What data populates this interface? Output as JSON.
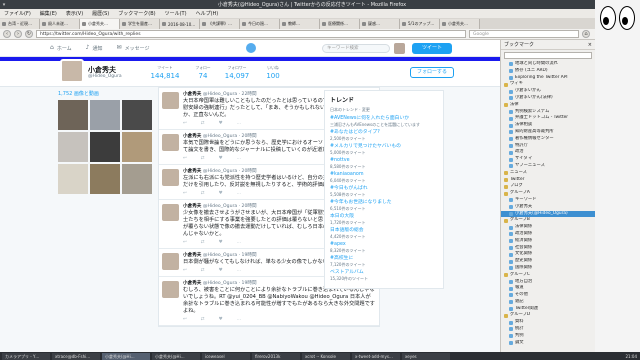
{
  "window": {
    "title": "小倉秀夫(@Hideo_Ogura)さん | Twitterからの反応付きツイート - Mozilla Firefox"
  },
  "menu": [
    "ファイル(F)",
    "編集(E)",
    "表示(V)",
    "履歴(S)",
    "ブックマーク(B)",
    "ツール(T)",
    "ヘルプ(H)"
  ],
  "tabs": [
    {
      "label": "台湾・近現…",
      "active": false
    },
    {
      "label": "殺人未遂…",
      "active": false
    },
    {
      "label": "小倉秀夫…",
      "active": true
    },
    {
      "label": "学生を量産…",
      "active": false
    },
    {
      "label": "2016-08-10…",
      "active": false
    },
    {
      "label": "《共謀罪》…",
      "active": false
    },
    {
      "label": "今日の過…",
      "active": false
    },
    {
      "label": "教師…",
      "active": false
    },
    {
      "label": "医療関係…",
      "active": false
    },
    {
      "label": "疑惑…",
      "active": false
    },
    {
      "label": "5/1のアップ…",
      "active": false
    },
    {
      "label": "小倉秀夫…",
      "active": false
    }
  ],
  "navbar": {
    "url": "https://twitter.com/Hideo_Ogura/with_replies",
    "search_placeholder": "Google"
  },
  "twitter": {
    "nav": [
      "ホーム",
      "通知",
      "メッセージ"
    ],
    "search_placeholder": "キーワード検索",
    "tweet_button": "ツイート",
    "profile": {
      "name": "小倉秀夫",
      "handle": "@Hideo_Ogura",
      "follow_button": "フォローする"
    },
    "stats": [
      {
        "label": "ツイート",
        "value": "144,814"
      },
      {
        "label": "フォロー",
        "value": "74"
      },
      {
        "label": "フォロワー",
        "value": "14,097"
      },
      {
        "label": "いいね",
        "value": "100"
      }
    ],
    "photos_label": "1,752 画像と動画",
    "photos": [
      {
        "color": "#6e6458"
      },
      {
        "color": "#9aa0a8"
      },
      {
        "color": "#4a4a4a"
      },
      {
        "color": "#c6c2bd"
      },
      {
        "color": "#3c3c3c"
      },
      {
        "color": "#b09a7a"
      },
      {
        "color": "#d9d4c8"
      },
      {
        "color": "#8c7b5e"
      },
      {
        "color": "#a49d90"
      }
    ],
    "tweets": [
      {
        "name": "小倉秀夫",
        "handle": "@Hideo_Ogura · 22時間",
        "text": "大日本帝国軍は難しいこともしたのだったとは思っているので、そのことが「従軍慰安婦の強制連行」だったとして、「まあ、そうかもしれないね」くらいの感覚しか、正直ないんだ。"
      },
      {
        "name": "小倉秀夫",
        "handle": "@Hideo_Ogura · 20時間",
        "text": "本気で国際世論をどうにか思うなら、歴史学におけるオーソドックスな手法を用いて論文を書き、国際的なジャーナルに投稿していくのが近道だと思うんだけどね。"
      },
      {
        "name": "小倉秀夫",
        "handle": "@Hideo_Ogura · 20時間",
        "text": "左派にも右派にも党派性を持つ歴史学者はいるけど、自分の主張に都合のいい資料だけを引用したり、反対説を無視したりすると、学術的評価は下がるんだよね。"
      },
      {
        "name": "小倉秀夫",
        "handle": "@Hideo_Ogura · 20時間",
        "text": "少女像を撤去させようがさせまいが、大日本帝国が「従軍慰安婦」を連れ回して兵士たちを相手にする事業を強要したとの評価は覆らないと思うんだけど、その評価が覆らない状態で像の撤去運動だけしていれば、むしろ日本の国際的評価が落ちるんじゃないかと。"
      },
      {
        "name": "小倉秀夫",
        "handle": "@Hideo_Ogura · 19時間",
        "text": "日本側が騒がなくてもしなければ、単なる少女の像でしかないわけだし。"
      },
      {
        "name": "小倉秀夫",
        "handle": "@Hideo_Ogura · 19時間",
        "text": "むしろ、被害をことに何かことにより余計なトラブルに巻き込まれているんじゃないでしょうね。RT @yui_0204_BB @NabiyoWakou @Hideo_Ogura 日本人が余計なトラブルに巻き込まれる可能性が増すでもたがあるなら大きな外交問題ですよね。"
      }
    ],
    "trends_title": "トレンド",
    "trends_subtitle": "日本のトレンド · 変更",
    "trends": [
      {
        "name": "#AVENewsに何を入れたら面白いか",
        "count": "三浦忍さんもAVEnewsのことを話題にしています"
      },
      {
        "name": "#あなたはどのタイプ?",
        "count": "2,500件のツイート"
      },
      {
        "name": "#メルカリで見つけたヤバいもの",
        "count": "5,000件のツイート"
      },
      {
        "name": "#nottve",
        "count": "8,580件のツイート"
      },
      {
        "name": "#kaniaoanom",
        "count": "6,040件のツイート"
      },
      {
        "name": "#今日もがんばれ",
        "count": "5,508件のツイート"
      },
      {
        "name": "#今年もお世話になりました",
        "count": "6,510件のツイート"
      },
      {
        "name": "本日の大阪",
        "count": "1,720件のツイート"
      },
      {
        "name": "日本語版の総会",
        "count": "4,420件のツイート"
      },
      {
        "name": "#apex",
        "count": "8,320件のツイート"
      },
      {
        "name": "#高校生に",
        "count": "7,120件のツイート"
      },
      {
        "name": "ベストアルバム",
        "count": "15,320件のツイート"
      }
    ]
  },
  "sidebar": {
    "title": "ブックマーク",
    "items": [
      {
        "label": "地球と同じ時間の流れ",
        "folder": false,
        "selected": false
      },
      {
        "label": "依存 (ユニ ARD)",
        "folder": false,
        "selected": false
      },
      {
        "label": "Exploring the Twitter API",
        "folder": false,
        "selected": false
      },
      {
        "label": "ウィキ",
        "folder": true,
        "selected": false
      },
      {
        "label": "小倉まいかん",
        "folder": false,
        "selected": false
      },
      {
        "label": "小倉まいかん(法律)",
        "folder": false,
        "selected": false
      },
      {
        "label": "法律",
        "folder": true,
        "selected": false
      },
      {
        "label": "判例検索システム",
        "folder": false,
        "selected": false
      },
      {
        "label": "弁護士ドットコム - Twitter",
        "folder": false,
        "selected": false
      },
      {
        "label": "法律相談",
        "folder": false,
        "selected": false
      },
      {
        "label": "知的財産高等裁判所",
        "folder": false,
        "selected": false
      },
      {
        "label": "著作権情報センター",
        "folder": false,
        "selected": false
      },
      {
        "label": "特許庁",
        "folder": false,
        "selected": false
      },
      {
        "label": "政治",
        "folder": false,
        "selected": false
      },
      {
        "label": "サイタマ",
        "folder": false,
        "selected": false
      },
      {
        "label": "ヤフーニュース",
        "folder": false,
        "selected": false
      },
      {
        "label": "ニュース",
        "folder": true,
        "selected": false
      },
      {
        "label": "Twitter",
        "folder": true,
        "selected": false
      },
      {
        "label": "ブログ",
        "folder": true,
        "selected": false
      },
      {
        "label": "グループA",
        "folder": true,
        "selected": false
      },
      {
        "label": "キーワード",
        "folder": false,
        "selected": false
      },
      {
        "label": "小倉秀夫",
        "folder": false,
        "selected": false
      },
      {
        "label": "小倉秀夫(@Hideo_Ogura)",
        "folder": false,
        "selected": true
      },
      {
        "label": "グループB",
        "folder": true,
        "selected": false
      },
      {
        "label": "法律関係",
        "folder": false,
        "selected": false
      },
      {
        "label": "政治関係",
        "folder": false,
        "selected": false
      },
      {
        "label": "経済関係",
        "folder": false,
        "selected": false
      },
      {
        "label": "社会関係",
        "folder": false,
        "selected": false
      },
      {
        "label": "文化関係",
        "folder": false,
        "selected": false
      },
      {
        "label": "歴史関係",
        "folder": false,
        "selected": false
      },
      {
        "label": "国際関係",
        "folder": false,
        "selected": false
      },
      {
        "label": "グループC",
        "folder": true,
        "selected": false
      },
      {
        "label": "地方自治",
        "folder": false,
        "selected": false
      },
      {
        "label": "報道",
        "folder": false,
        "selected": false
      },
      {
        "label": "その他",
        "folder": false,
        "selected": false
      },
      {
        "label": "雑記",
        "folder": false,
        "selected": false
      },
      {
        "label": "Twitter関連",
        "folder": false,
        "selected": false
      },
      {
        "label": "グループD",
        "folder": true,
        "selected": false
      },
      {
        "label": "資料",
        "folder": false,
        "selected": false
      },
      {
        "label": "統計",
        "folder": false,
        "selected": false
      },
      {
        "label": "判例",
        "folder": false,
        "selected": false
      },
      {
        "label": "論文",
        "folder": false,
        "selected": false
      }
    ]
  },
  "taskbar": {
    "items": [
      {
        "label": "カメラアプリ - Y…",
        "active": false
      },
      {
        "label": "xtrace@db-Fshi…",
        "active": false
      },
      {
        "label": "小倉秀夫(@Hi…",
        "active": true
      },
      {
        "label": "小倉秀夫(@Hi…",
        "active": false
      },
      {
        "label": "iceweasel",
        "active": false
      },
      {
        "label": "firerov2013k",
        "active": false
      },
      {
        "label": "xcrot -- Konsole",
        "active": false
      },
      {
        "label": "x-tweet-add-mys…",
        "active": false
      },
      {
        "label": "xeyes",
        "active": false
      }
    ],
    "clock": "21:04"
  }
}
